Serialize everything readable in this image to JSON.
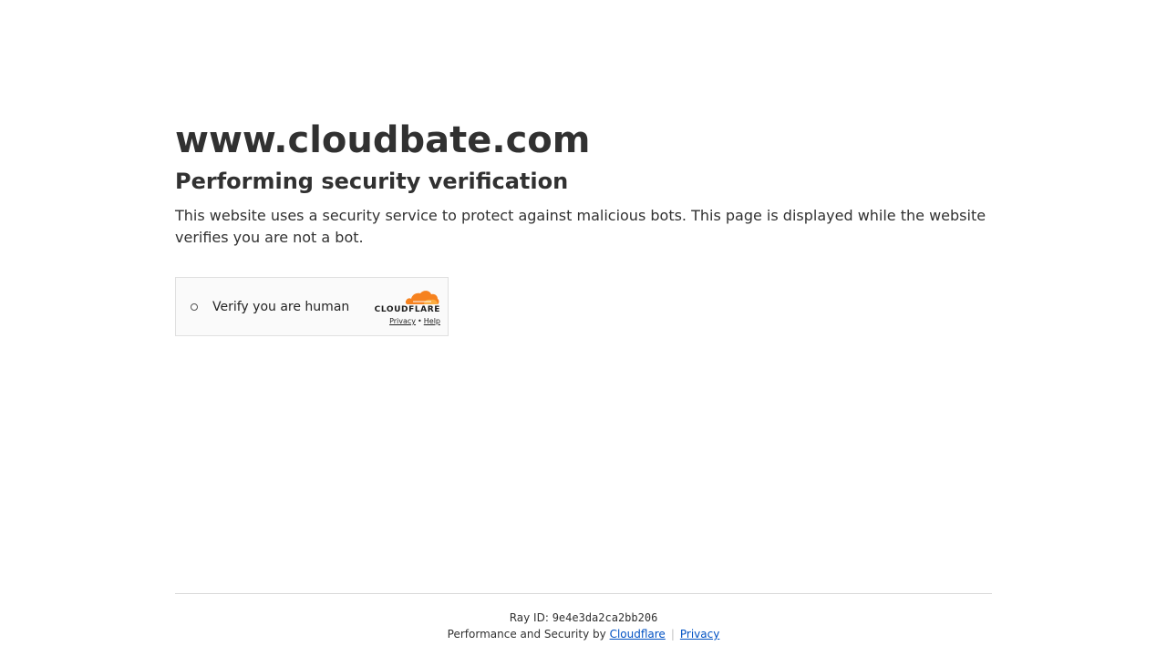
{
  "site": {
    "domain": "www.cloudbate.com",
    "heading": "Performing security verification",
    "description": "This website uses a security service to protect against malicious bots. This page is displayed while the website verifies you are not a bot."
  },
  "widget": {
    "checkbox_label": "Verify you are human",
    "brand": "CLOUDFLARE",
    "privacy_link": "Privacy",
    "separator": "•",
    "help_link": "Help"
  },
  "footer": {
    "ray_label": "Ray ID:",
    "ray_id": "9e4e3da2ca2bb206",
    "performance_text": "Performance and Security by",
    "cloudflare_link": "Cloudflare",
    "divider": "|",
    "privacy_link": "Privacy"
  },
  "colors": {
    "text": "#313131",
    "link": "#0051c3",
    "brand_orange": "#f6821f"
  }
}
